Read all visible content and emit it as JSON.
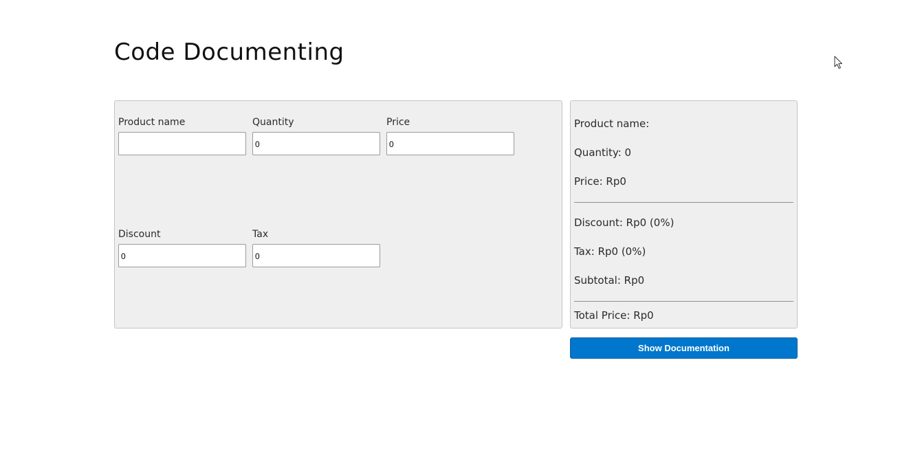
{
  "header": {
    "title": "Code Documenting"
  },
  "form": {
    "product_name": {
      "label": "Product name",
      "value": ""
    },
    "quantity": {
      "label": "Quantity",
      "value": "0"
    },
    "price": {
      "label": "Price",
      "value": "0"
    },
    "discount": {
      "label": "Discount",
      "value": "0"
    },
    "tax": {
      "label": "Tax",
      "value": "0"
    }
  },
  "summary": {
    "product_name": "Product name:",
    "quantity": "Quantity: 0",
    "price": "Price: Rp0",
    "discount": "Discount: Rp0 (0%)",
    "tax": "Tax: Rp0 (0%)",
    "subtotal": "Subtotal: Rp0",
    "total": "Total Price: Rp0"
  },
  "actions": {
    "show_documentation_label": "Show Documentation"
  },
  "colors": {
    "accent": "#0077cc",
    "panel_background": "#efefef"
  },
  "icons": {
    "cursor": "mouse-pointer-icon"
  }
}
